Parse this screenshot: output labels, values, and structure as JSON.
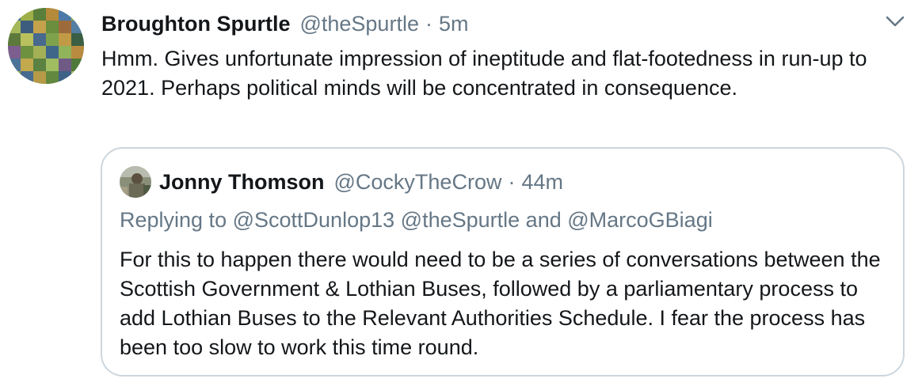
{
  "tweet": {
    "display_name": "Broughton Spurtle",
    "handle": "@theSpurtle",
    "separator": "·",
    "time": "5m",
    "text": "Hmm. Gives unfortunate impression of ineptitude and flat-footedness in run-up to 2021. Perhaps political minds will be concentrated in consequence."
  },
  "quoted_tweet": {
    "display_name": "Jonny Thomson",
    "handle": "@CockyTheCrow",
    "separator": "·",
    "time": "44m",
    "replying_prefix": "Replying to",
    "reply_mention_1": "@ScottDunlop13",
    "reply_mention_2": "@theSpurtle",
    "reply_and": "and",
    "reply_mention_3": "@MarcoGBiagi",
    "text": "For this to happen there would need to be a series of conversations between the Scottish Government & Lothian Buses, followed by a parliamentary process to add Lothian Buses to the Relevant Authorities Schedule. I fear the process has been too slow to work this time round."
  },
  "icons": {
    "avatar": "mosaic-avatar-image",
    "quoted_avatar": "photo-avatar-image",
    "menu": "chevron-down-icon"
  },
  "colors": {
    "text_primary": "#14171a",
    "text_secondary": "#657786",
    "border": "#ccd6dd"
  }
}
